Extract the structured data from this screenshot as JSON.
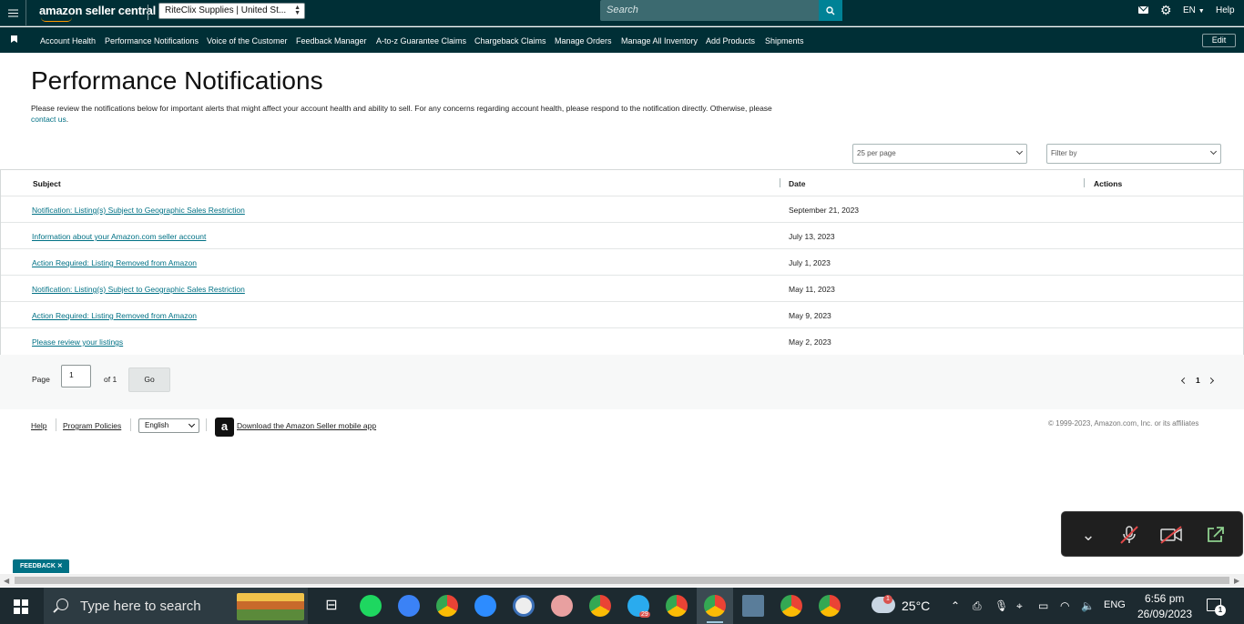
{
  "topbar": {
    "logo_text": "amazon seller central",
    "store": "RiteClix Supplies | United St...",
    "search_placeholder": "Search",
    "language": "EN",
    "help": "Help"
  },
  "nav": {
    "items": [
      "Account Health",
      "Performance Notifications",
      "Voice of the Customer",
      "Feedback Manager",
      "A-to-z Guarantee Claims",
      "Chargeback Claims",
      "Manage Orders",
      "Manage All Inventory",
      "Add Products",
      "Shipments"
    ],
    "edit": "Edit"
  },
  "page": {
    "title": "Performance Notifications",
    "intro": "Please review the notifications below for important alerts that might affect your account health and ability to sell. For any concerns regarding account health, please respond to the notification directly. Otherwise, please",
    "contact_link": "contact us",
    "per_page": "25 per page",
    "filter_placeholder": "Filter by"
  },
  "table": {
    "headers": {
      "subject": "Subject",
      "date": "Date",
      "actions": "Actions"
    },
    "rows": [
      {
        "subject": "Notification: Listing(s) Subject to Geographic Sales Restriction",
        "date": "September 21, 2023"
      },
      {
        "subject": "Information about your Amazon.com seller account",
        "date": "July 13, 2023"
      },
      {
        "subject": "Action Required: Listing Removed from Amazon",
        "date": "July 1, 2023"
      },
      {
        "subject": "Notification: Listing(s) Subject to Geographic Sales Restriction",
        "date": "May 11, 2023"
      },
      {
        "subject": "Action Required: Listing Removed from Amazon",
        "date": "May 9, 2023"
      },
      {
        "subject": "Please review your listings",
        "date": "May 2, 2023"
      }
    ]
  },
  "pager": {
    "page_label": "Page",
    "page_value": "1",
    "of_label": "of 1",
    "go": "Go",
    "current": "1"
  },
  "footer": {
    "help": "Help",
    "program_policies": "Program Policies",
    "language": "English",
    "app_download": "Download the Amazon Seller mobile app",
    "copyright": "© 1999-2023, Amazon.com, Inc. or its affiliates"
  },
  "feedback": "FEEDBACK",
  "taskbar": {
    "search_text": "Type here to search",
    "telegram_badge": "29",
    "weather_badge": "1",
    "temperature": "25°C",
    "input_lang": "ENG",
    "time": "6:56 pm",
    "date": "26/09/2023",
    "notification_count": "1"
  },
  "colors": {
    "topbar": "#002f36",
    "link": "#007185",
    "search_button": "#008296"
  }
}
